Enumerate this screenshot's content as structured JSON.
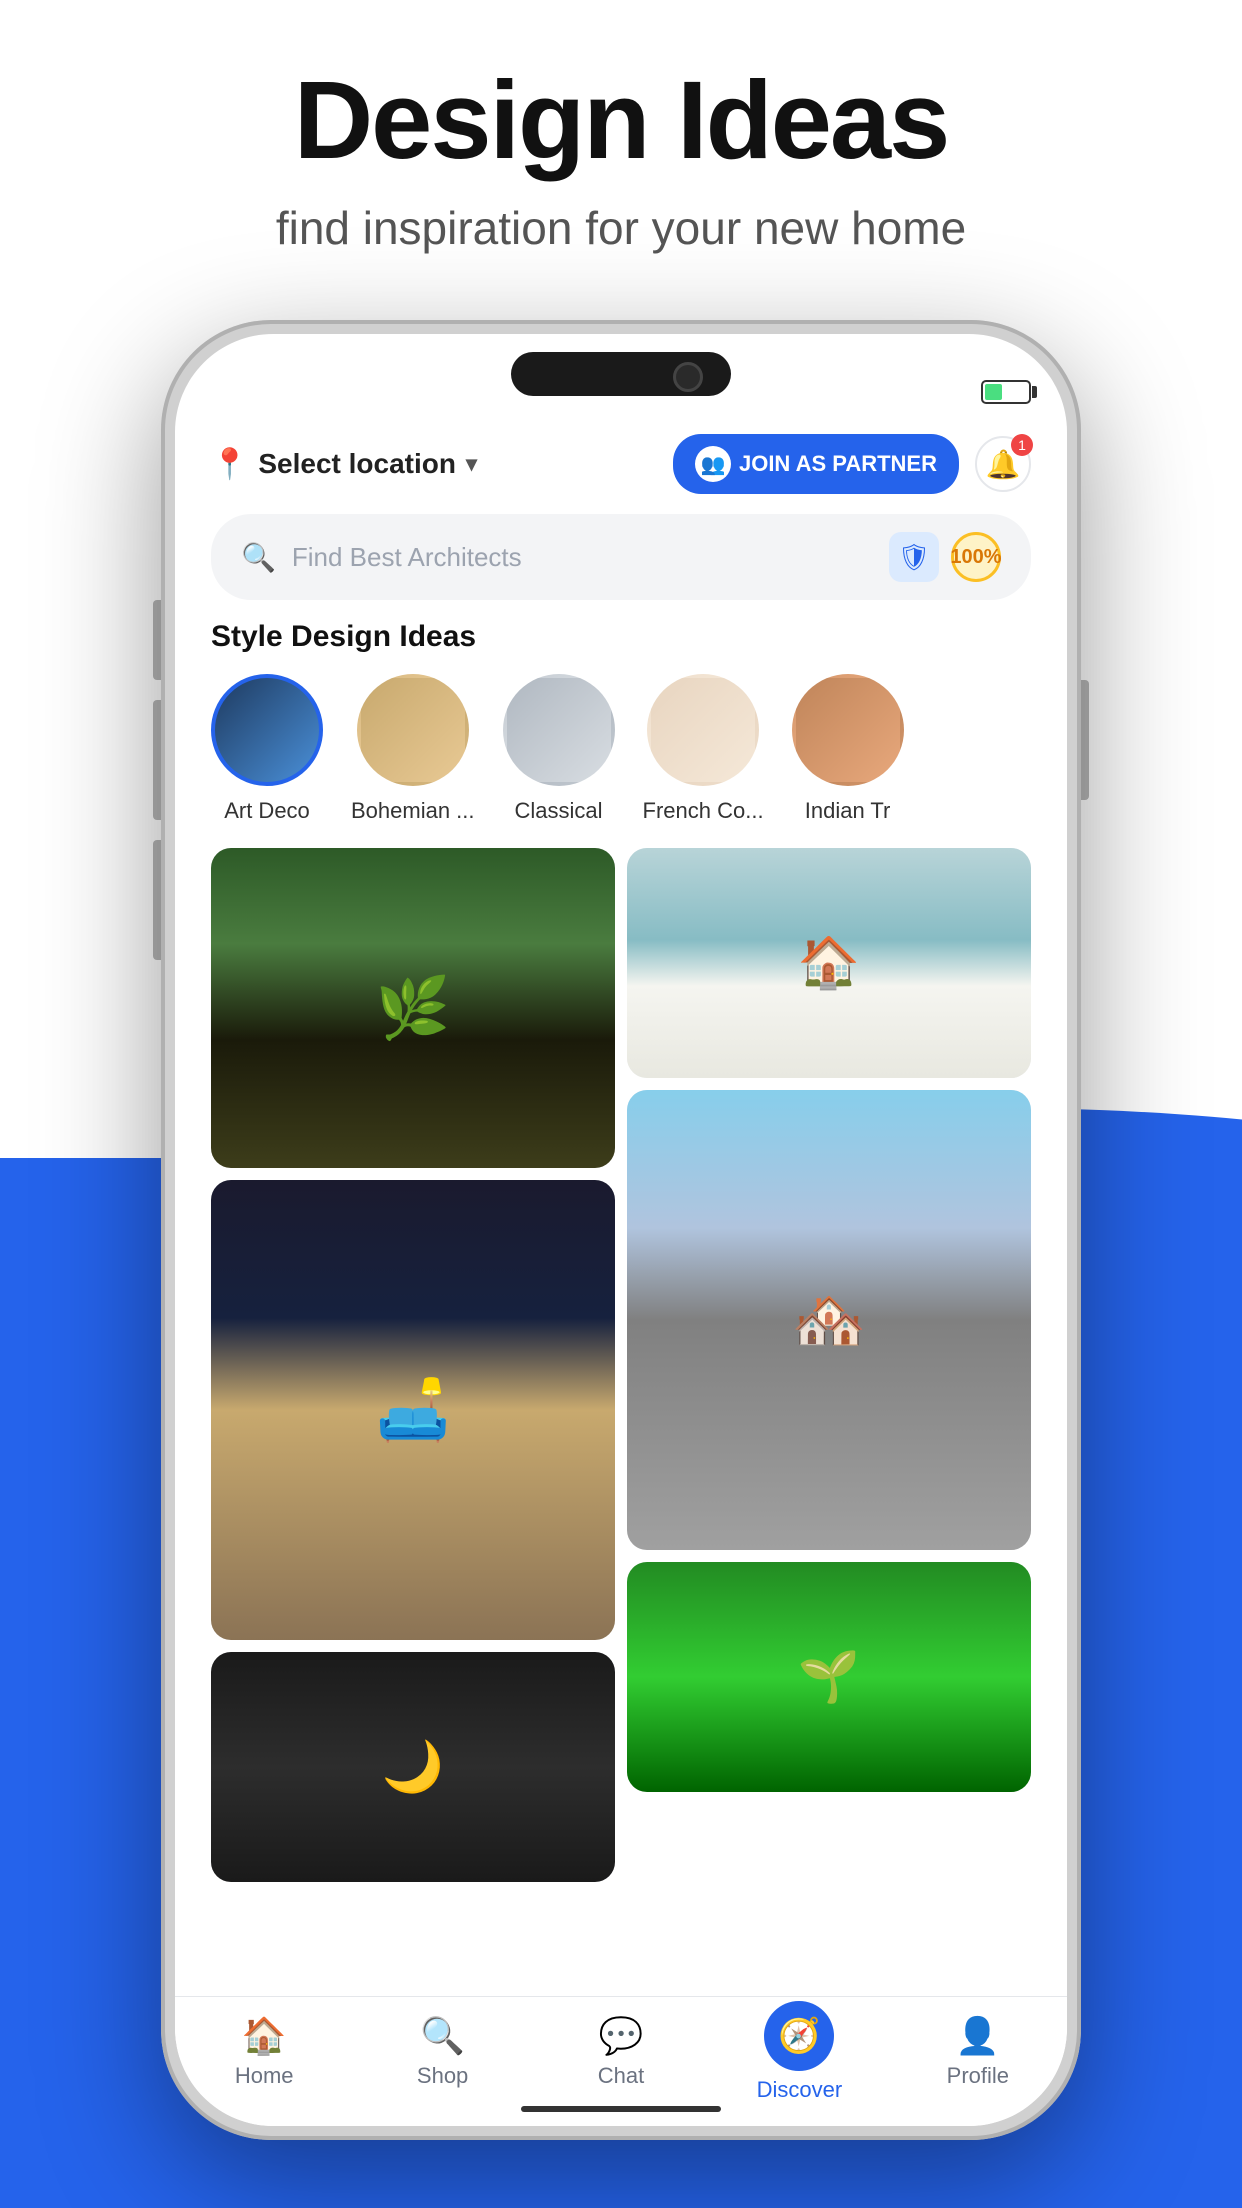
{
  "hero": {
    "title": "Design Ideas",
    "subtitle": "find inspiration for your new home"
  },
  "header": {
    "location": "Select location",
    "join_partner": "JOIN AS PARTNER",
    "notification_count": "1"
  },
  "search": {
    "placeholder": "Find Best Architects"
  },
  "styles_section": {
    "title": "Style Design Ideas",
    "items": [
      {
        "label": "Art Deco",
        "active": true
      },
      {
        "label": "Bohemian ...",
        "active": false
      },
      {
        "label": "Classical",
        "active": false
      },
      {
        "label": "French Co...",
        "active": false
      },
      {
        "label": "Indian Tr",
        "active": false
      }
    ]
  },
  "nav": {
    "items": [
      {
        "label": "Home",
        "icon": "🏠",
        "active": false
      },
      {
        "label": "Shop",
        "icon": "🔍",
        "active": false
      },
      {
        "label": "Chat",
        "icon": "💬",
        "active": false
      },
      {
        "label": "Discover",
        "icon": "🧭",
        "active": true
      },
      {
        "label": "Profile",
        "icon": "👤",
        "active": false
      }
    ]
  },
  "colors": {
    "accent": "#2563eb",
    "active_nav": "#2563eb",
    "bg_blue": "#2563eb"
  }
}
